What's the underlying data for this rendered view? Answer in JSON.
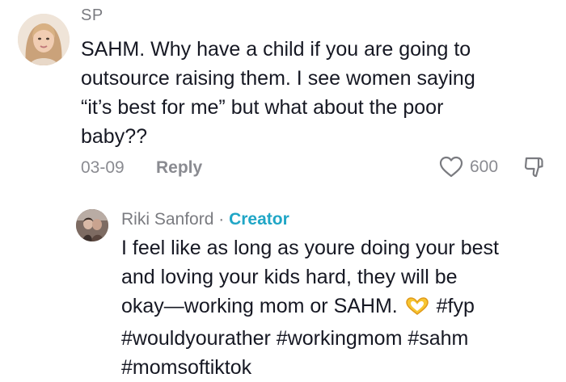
{
  "comment": {
    "username": "SP",
    "lines": [
      "SAHM. Why have a child if you are going to",
      "outsource raising them. I see women saying",
      "“it’s best for me” but what about the poor",
      "baby??"
    ],
    "date": "03-09",
    "reply_label": "Reply",
    "like_count": "600"
  },
  "reply": {
    "username": "Riki Sanford",
    "separator": "·",
    "badge": "Creator",
    "lines": [
      "I feel like as long as youre doing your best",
      "and loving your kids hard, they will be",
      "okay—working mom or SAHM.",
      "#wouldyourather #workingmom #sahm",
      "#momsoftiktok"
    ],
    "line3_suffix": "#fyp"
  },
  "icons": {
    "like": "heart-outline-icon",
    "dislike": "thumbs-down-icon",
    "emoji": "heart-hands-emoji"
  },
  "colors": {
    "creator_badge": "#20a6c6",
    "muted_text": "#8a8b91",
    "body_text": "#161823"
  }
}
